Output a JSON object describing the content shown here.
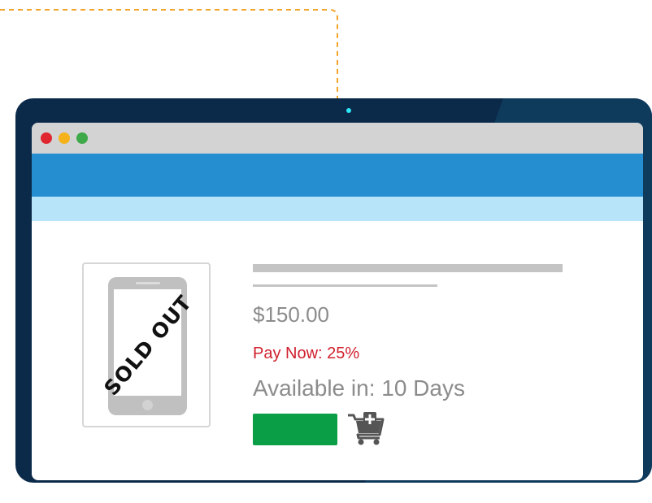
{
  "window": {
    "controls": [
      "close",
      "minimize",
      "maximize"
    ]
  },
  "product": {
    "image_icon": "smartphone-icon",
    "overlay_text": "SOLD OUT",
    "price": "$150.00",
    "pay_now": "Pay Now: 25%",
    "availability": "Available in: 10 Days",
    "cart_icon": "add-to-cart-icon"
  },
  "colors": {
    "tablet_frame": "#0b2a4a",
    "titlebar": "#d3d3d3",
    "navbar": "#248ed0",
    "subbar": "#b8e4fa",
    "pay_now_text": "#d0202e",
    "buy_button": "#0a9e47",
    "dashed_connector": "#f3a52b"
  }
}
